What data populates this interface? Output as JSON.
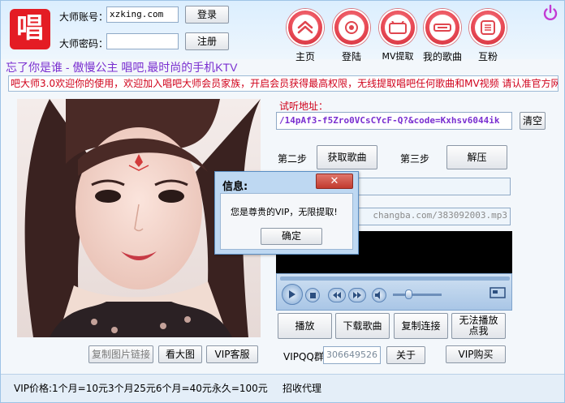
{
  "login": {
    "account_label": "大师账号：",
    "account_value": "xzking.com",
    "password_label": "大师密码：",
    "password_value": "",
    "login_button": "登录",
    "register_button": "注册"
  },
  "logo": {
    "glyph": "唱"
  },
  "nav": {
    "items": [
      {
        "label": "主页",
        "icon": "home-icon"
      },
      {
        "label": "登陆",
        "icon": "login-icon"
      },
      {
        "label": "MV提取",
        "icon": "mv-extract-icon"
      },
      {
        "label": "我的歌曲",
        "icon": "my-songs-icon"
      },
      {
        "label": "互粉",
        "icon": "follow-icon"
      }
    ],
    "power_icon": "power-icon"
  },
  "slogan": "忘了你是谁 - 傲慢公主 唱吧,最时尚的手机KTV",
  "marquee": "吧大师3.0欢迎你的使用，欢迎加入唱吧大师会员家族，开启会员获得最高权限，无线提取唱吧任何歌曲和MV视频  请认准官方网",
  "trial": {
    "label": "试听地址：",
    "url": "/14pAf3-f5Zro0VCsCYcF-Q?&code=Kxhsv6044ik",
    "clear_button": "清空"
  },
  "steps": {
    "step2_label": "第二步",
    "get_song_button": "获取歌曲",
    "step3_label": "第三步",
    "unzip_button": "解压"
  },
  "fields": {
    "song_name": "",
    "mp3_url": "changba.com/383092003.mp3"
  },
  "dialog": {
    "title": "信息:",
    "close": "✕",
    "message": "您是尊贵的VIP，无限提取!",
    "ok_button": "确定"
  },
  "player": {
    "progress": 0.32
  },
  "actions": {
    "play_button": "播放",
    "download_button": "下载歌曲",
    "copy_link_button": "复制连接",
    "cant_play_button": "无法播放点我"
  },
  "bottom": {
    "copy_image_link": "复制图片链接",
    "view_large": "看大图",
    "vip_service": "VIP客服",
    "vip_qq_label": "VIPQQ群",
    "vip_qq_value": "306649526",
    "about_button": "关于",
    "vip_buy_button": "VIP购买"
  },
  "footer": {
    "price": "VIP价格:1个月=10元3个月25元6个月=40元永久=100元",
    "agents": "招收代理"
  },
  "colors": {
    "accent_red": "#e41c24",
    "marquee_text": "#d0021b",
    "slogan_purple": "#7a2fd0"
  }
}
